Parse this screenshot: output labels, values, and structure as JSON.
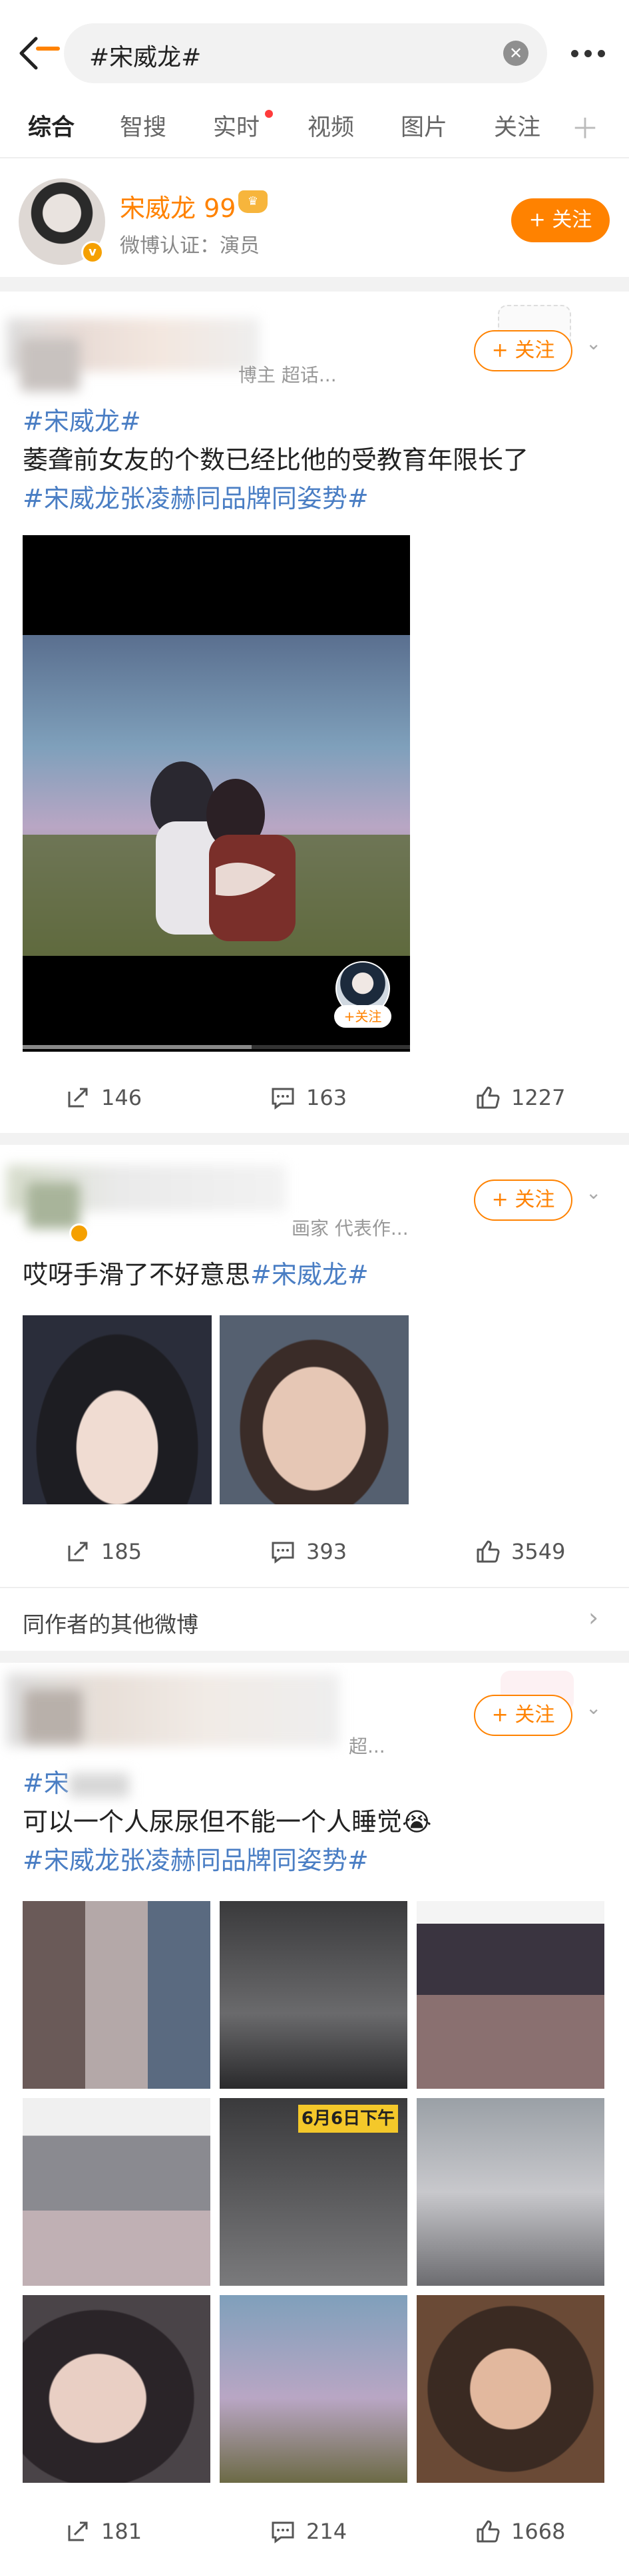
{
  "search": {
    "query": "#宋威龙#",
    "clear_icon": "close-circle-icon",
    "more_icon": "more-dots-icon",
    "back_icon": "back-arrow-icon"
  },
  "tabs": [
    "综合",
    "智搜",
    "实时",
    "视频",
    "图片",
    "关注"
  ],
  "profile": {
    "name": "宋威龙",
    "level": "99",
    "verification": "微博认证：演员",
    "follow_label": "+ 关注"
  },
  "posts": [
    {
      "author_meta": "博主 超话...",
      "follow_label": "+ 关注",
      "text_lines": [
        {
          "parts": [
            {
              "t": "#宋威龙#",
              "tag": true
            }
          ]
        },
        {
          "parts": [
            {
              "t": "萎聋前女友的个数已经比他的受教育年限长了",
              "tag": false
            }
          ]
        },
        {
          "parts": [
            {
              "t": "#宋威龙张凌赫同品牌同姿势#",
              "tag": true
            }
          ]
        }
      ],
      "video_follow_label": "+关注",
      "stats": {
        "reposts": "146",
        "comments": "163",
        "likes": "1227"
      }
    },
    {
      "author_meta": "画家 代表作...",
      "follow_label": "+ 关注",
      "text_lines": [
        {
          "parts": [
            {
              "t": "哎呀手滑了不好意思",
              "tag": false
            },
            {
              "t": "#宋威龙#",
              "tag": true
            }
          ]
        }
      ],
      "stats": {
        "reposts": "185",
        "comments": "393",
        "likes": "3549"
      },
      "others_label": "同作者的其他微博"
    },
    {
      "author_meta": "超...",
      "follow_label": "+ 关注",
      "text_lines": [
        {
          "parts": [
            {
              "t": "#宋",
              "tag": true
            }
          ]
        },
        {
          "parts": [
            {
              "t": "可以一个人尿尿但不能一个人睡觉😭",
              "tag": false
            }
          ]
        },
        {
          "parts": [
            {
              "t": "#宋威龙张凌赫同品牌同姿势#",
              "tag": true
            }
          ]
        }
      ],
      "image_captions": {
        "date_sticker": "6月6日下午"
      },
      "stats": {
        "reposts": "181",
        "comments": "214",
        "likes": "1668"
      }
    }
  ],
  "colors": {
    "accent": "#ff8200",
    "hashtag": "#4a7ec4",
    "gap": "#f2f2f2"
  }
}
